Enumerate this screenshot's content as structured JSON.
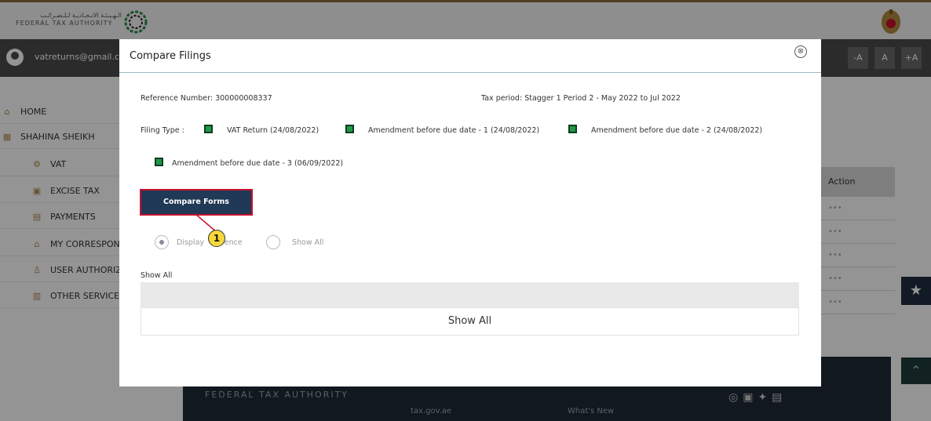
{
  "topbar": {
    "logo_ar": "الـهـيـئـة الاتـحـاديـة لـلـضـرائـب",
    "logo_en": "FEDERAL TAX AUTHORITY"
  },
  "userbar": {
    "email": "vatreturns@gmail.co",
    "font_controls": [
      "-A",
      "A",
      "+A"
    ]
  },
  "sidebar": {
    "items": [
      {
        "label": "HOME",
        "icon": "home-icon"
      },
      {
        "label": "SHAHINA SHEIKH",
        "icon": "grid-icon"
      },
      {
        "label": "VAT",
        "icon": "vat-icon"
      },
      {
        "label": "EXCISE TAX",
        "icon": "excise-icon"
      },
      {
        "label": "PAYMENTS",
        "icon": "payments-icon"
      },
      {
        "label": "MY CORRESPON",
        "icon": "correspondence-icon"
      },
      {
        "label": "USER AUTHORIZ",
        "icon": "user-auth-icon"
      },
      {
        "label": "OTHER SERVICE",
        "icon": "services-icon"
      }
    ]
  },
  "background_table": {
    "action_header": "Action",
    "row_dots": [
      "•••",
      "•••",
      "•••",
      "•••",
      "•••"
    ]
  },
  "footer": {
    "name": "FEDERAL TAX AUTHORITY",
    "link1": "tax.gov.ae",
    "link2": "What's New"
  },
  "modal": {
    "title": "Compare Filings",
    "close_glyph": "⊗",
    "reference_label": "Reference Number:",
    "reference_value": "300000008337",
    "tax_period_label": "Tax period:",
    "tax_period_value": "Stagger 1 Period 2 - May 2022 to Jul 2022",
    "filing_type_label": "Filing Type :",
    "filings": [
      "VAT Return (24/08/2022)",
      "Amendment before due date - 1 (24/08/2022)",
      "Amendment before due date - 2 (24/08/2022)",
      "Amendment before due date - 3 (06/09/2022)"
    ],
    "compare_button": "Compare Forms",
    "annotation_number": "1",
    "radio_display_difference": "Display",
    "radio_display_difference_tail": "rence",
    "radio_show_all": "Show All",
    "section_label": "Show All",
    "show_all_box": "Show All"
  }
}
